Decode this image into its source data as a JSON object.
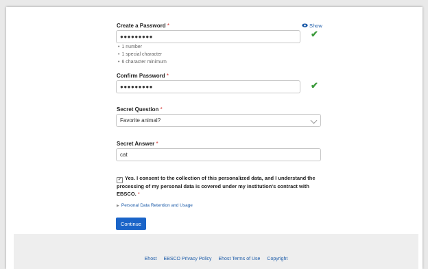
{
  "password": {
    "label": "Create a Password",
    "required_mark": "*",
    "show_label": "Show",
    "value": "●●●●●●●●●",
    "rules": [
      "1 number",
      "1 special character",
      "6 character minimum"
    ]
  },
  "confirm": {
    "label": "Confirm Password",
    "required_mark": "*",
    "value": "●●●●●●●●●"
  },
  "question": {
    "label": "Secret Question",
    "required_mark": "*",
    "value": "Favorite animal?"
  },
  "answer": {
    "label": "Secret Answer",
    "required_mark": "*",
    "value": "cat"
  },
  "consent": {
    "checked_mark": "✓",
    "text": "Yes. I consent to the collection of this personalized data, and I understand the processing of my personal data is covered under my institution's contract with EBSCO.",
    "required_mark": "*"
  },
  "retention_link": "Personal Data Retention and Usage",
  "continue_label": "Continue",
  "footer": {
    "links": [
      "Ehost",
      "EBSCO Privacy Policy",
      "Ehost Terms of Use",
      "Copyright"
    ]
  },
  "colors": {
    "accent": "#1a64c8",
    "success": "#3b9a3b",
    "required": "#d2312f"
  }
}
